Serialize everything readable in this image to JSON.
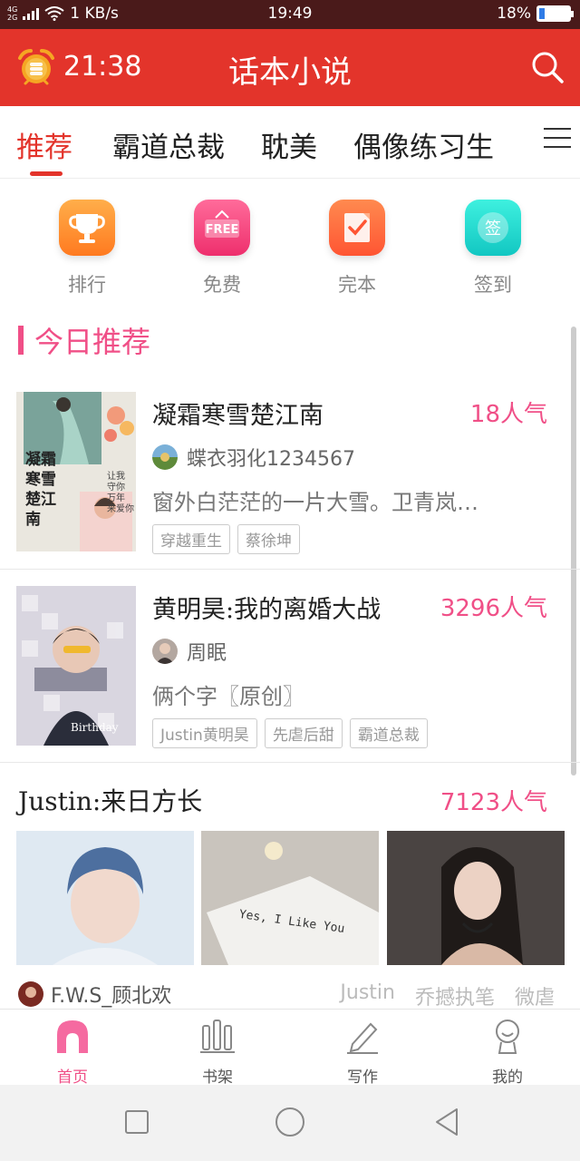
{
  "status_bar": {
    "network_top": "4G",
    "network_bottom": "2G",
    "speed": "1 KB/s",
    "time": "19:49",
    "battery": "18%",
    "battery_level": 0.18
  },
  "header": {
    "clock": "21:38",
    "title": "话本小说",
    "accent_color": "#e3342b"
  },
  "tabs": [
    {
      "label": "推荐",
      "active": true
    },
    {
      "label": "霸道总裁",
      "active": false
    },
    {
      "label": "耽美",
      "active": false
    },
    {
      "label": "偶像练习生",
      "active": false
    }
  ],
  "quick_actions": [
    {
      "label": "排行",
      "icon": "trophy-icon",
      "color": "#ff8a2a"
    },
    {
      "label": "免费",
      "icon": "free-sign-icon",
      "color": "#f4417c"
    },
    {
      "label": "完本",
      "icon": "check-note-icon",
      "color": "#ff6a3d"
    },
    {
      "label": "签到",
      "icon": "sign-in-badge-icon",
      "color": "#19d4c9"
    }
  ],
  "section": {
    "title": "今日推荐",
    "color": "#f04f87"
  },
  "books": [
    {
      "title": "凝霜寒雪楚江南",
      "popularity": "18人气",
      "author": "蝶衣羽化1234567",
      "description": "窗外白茫茫的一片大雪。卫青岚…",
      "tags": [
        "穿越重生",
        "蔡徐坤"
      ],
      "cover_text": "凝霜寒雪楚江南",
      "cover_sub": "让我守你万年来爱你"
    },
    {
      "title": "黄明昊:我的离婚大战",
      "popularity": "3296人气",
      "author": "周眠",
      "description": "俩个字〖原创〗",
      "tags": [
        "Justin黄明昊",
        "先虐后甜",
        "霸道总裁"
      ],
      "cover_text": "Birthday"
    }
  ],
  "featured": {
    "title": "Justin:来日方长",
    "popularity": "7123人气",
    "image_caption": "Yes, I Like You",
    "author": "F.W.S_顾北欢",
    "tags": [
      "Justin",
      "乔撼执笔",
      "微虐"
    ]
  },
  "bottom_nav": [
    {
      "label": "首页",
      "icon": "home-icon",
      "active": true
    },
    {
      "label": "书架",
      "icon": "bookshelf-icon",
      "active": false
    },
    {
      "label": "写作",
      "icon": "pen-icon",
      "active": false
    },
    {
      "label": "我的",
      "icon": "profile-icon",
      "active": false
    }
  ]
}
